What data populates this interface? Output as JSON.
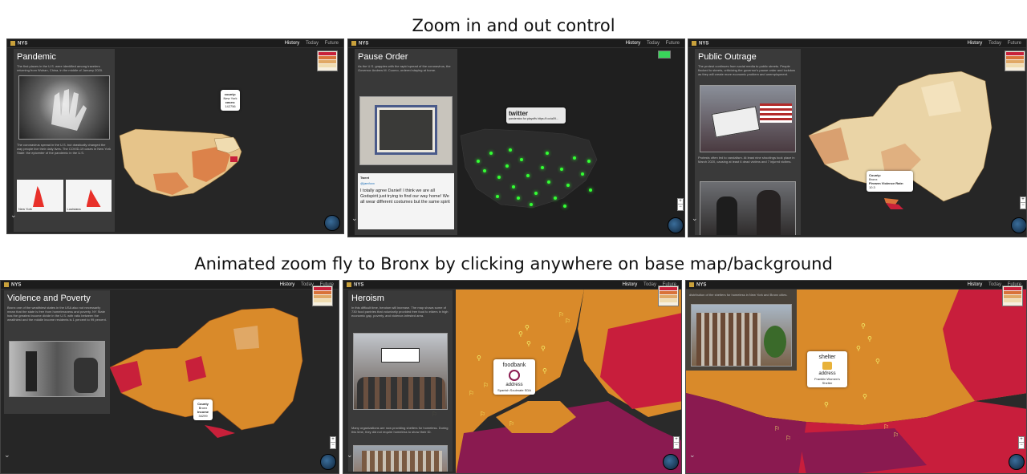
{
  "captions": {
    "top": "Zoom in and out control",
    "bottom": "Animated zoom fly to Bronx by clicking anywhere on base map/background"
  },
  "app": {
    "logo": "NYS",
    "nav": [
      "History",
      "Today",
      "Future"
    ]
  },
  "colors": {
    "map_dark": "#2a2a2a",
    "county_light": "#f0dcb0",
    "county_mid": "#e0a866",
    "county_dark": "#d9723a",
    "county_red": "#c8203a",
    "bronx_orange": "#d98a2a",
    "bronx_magenta": "#8a1a50",
    "tweet_green": "#33ff33"
  },
  "panels": [
    {
      "id": "pandemic",
      "title": "Pandemic",
      "text": "The first places in the U.S. were identified among travelers returning from Wuhan, China, in the middle of January 2020.",
      "text2": "The coronavirus spread in the U.S. but drastically changed the way people live their daily lives. The COVID-19 cases in New York State: the epicenter of the pandemic in the U.S.",
      "charts": [
        "New York",
        "Louisiana"
      ],
      "popup": {
        "line1": "county:",
        "line2": "New York",
        "line3": "cases:",
        "line4": "142756"
      }
    },
    {
      "id": "pause-order",
      "title": "Pause Order",
      "text": "As the U.S. grapples with the rapid spread of the coronavirus, the Governor Andrew M. Cuomo, ordered staying at home.",
      "tweet": {
        "label": "Tweet",
        "user": "@jamfoxx",
        "body": "I totally agree Daniel! I think we are all Godspirit just trying to find our way home! We all wear different costumes but the same spirit"
      },
      "popup": {
        "title": "twitter",
        "line1": "pandemics for playoffs https://t.co/a09..."
      }
    },
    {
      "id": "public-outrage",
      "title": "Public Outrage",
      "text": "The protest continues from social media to public streets. People flocked to streets, criticizing the governor's pause order and lockdow as they will create more economic problem and unemployment.",
      "text2": "Protests often led to vandalism. At least nine shootings took place in March 2020, causing at least 6 dead victims and 7 injured victims.",
      "popup": {
        "line1": "County:",
        "line2": "Bronx",
        "line3": "Firearm Violence Rate:",
        "line4": "10.3"
      }
    },
    {
      "id": "violence-poverty",
      "title": "Violence and Poverty",
      "text": "Bronx one of the wealthiest states in the USA also not necessarily mean that the state is free from homelessness and poverty. NY State has the greatest income divide in the U.S. with ratio between the wealthiest and the middle income residents is 1 percent to 99 percent.",
      "popup": {
        "line1": "County",
        "line2": "Bronx",
        "line3": "Income",
        "line4": "34299"
      }
    },
    {
      "id": "heroism",
      "title": "Heroism",
      "text": "In this difficult time, heroism will increase. The map shows some of 730 food pantries that voluntarily provided free food to elders in high economic gap, poverty, and violence-infested area.",
      "text2": "Many organizations are now providing shelters for homeless. During this time, they did not require homeless to show their ID.",
      "popup": {
        "title": "foodbank",
        "sub": "address",
        "line1": "Spanish Soulmate SDA"
      }
    },
    {
      "id": "shelter",
      "title": "",
      "text": "distribution of the shelters for homeless in New York and Bronx cities.",
      "popup": {
        "title": "shelter",
        "sub": "address",
        "line1": "Franklin Women's Shelter"
      }
    }
  ],
  "legend": {
    "rows": [
      "#c8203a",
      "#d9723a",
      "#e0a866",
      "#f0dcb0"
    ]
  }
}
